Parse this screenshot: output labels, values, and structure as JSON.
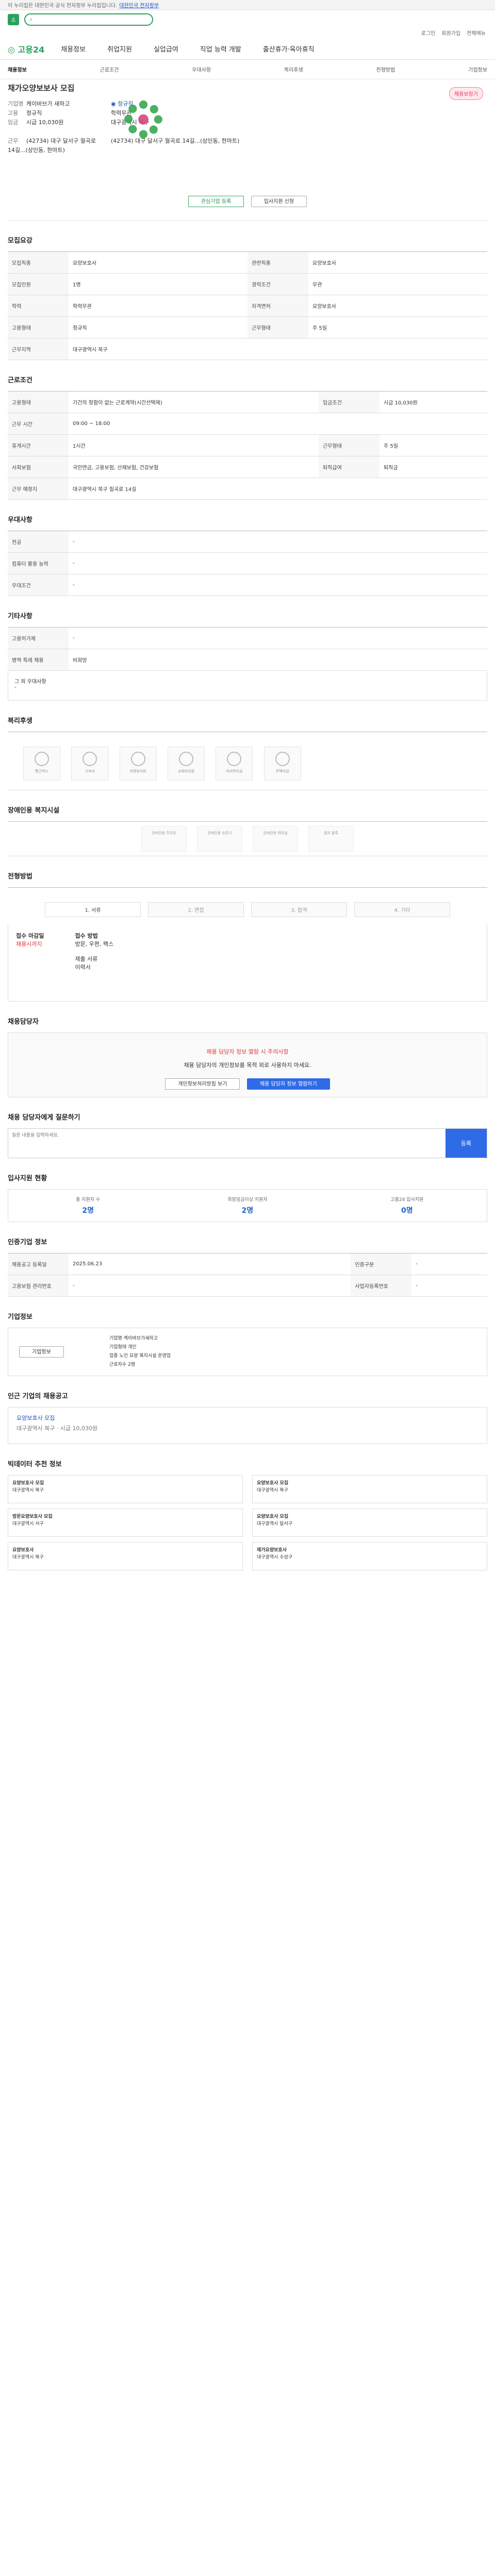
{
  "topbar": {
    "notice": "이 누리집은 대한민국 공식 전자정부 누리집입니다.",
    "link": "대한민국 전자정부"
  },
  "brand": {
    "name": "고용24",
    "utility": [
      "로그인",
      "회원가입",
      "전체메뉴"
    ]
  },
  "gnb": [
    "채용정보",
    "취업지원",
    "실업급여",
    "직업 능력 개발",
    "출산휴가·육아휴직"
  ],
  "lnb": [
    "채용정보",
    "근로조건",
    "우대사항",
    "복리후생",
    "전형방법",
    "기업정보"
  ],
  "job": {
    "title": "채가오양보보사 모집",
    "badge": "채용보장기",
    "company": "케이바브가 새하고",
    "employment": "정규직",
    "wage": "시급 10,030원",
    "address": "(42734) 대구 달서구 월곡로 14길...(상인동, 한마트)"
  },
  "buttons": {
    "save": "관심기업 등록",
    "apply": "입사지원 신청"
  },
  "sections": [
    "모집요강",
    "근로조건",
    "우대사항",
    "기타사항",
    "복리후생",
    "장애인용 복지시설",
    "전형방법",
    "채용담당자",
    "입사지원 현황",
    "인증기업 정보",
    "기업정보",
    "인근 기업의 채용공고",
    "빅데이터 추천 정보"
  ],
  "conditions": {
    "jobType": "요양보호사",
    "workHours": "09:00 ~ 18:00",
    "insurance": "국민연금, 고용보험, 산재보험, 건강보험",
    "location": "대구광역시 북구 칠곡로 14길"
  },
  "application": {
    "count": "2명",
    "requirements": "0명"
  },
  "company": {
    "name": "케이바브가새하고",
    "type": "개인",
    "industry": "노인 요양 복지시설 운영업",
    "employees": "2명"
  },
  "recommendations": [
    "요양보호사 모집",
    "요양보호사 모집",
    "방문요양보호사 모집",
    "요양보호사 모집",
    "요양보호사",
    "재가요양보호사"
  ]
}
